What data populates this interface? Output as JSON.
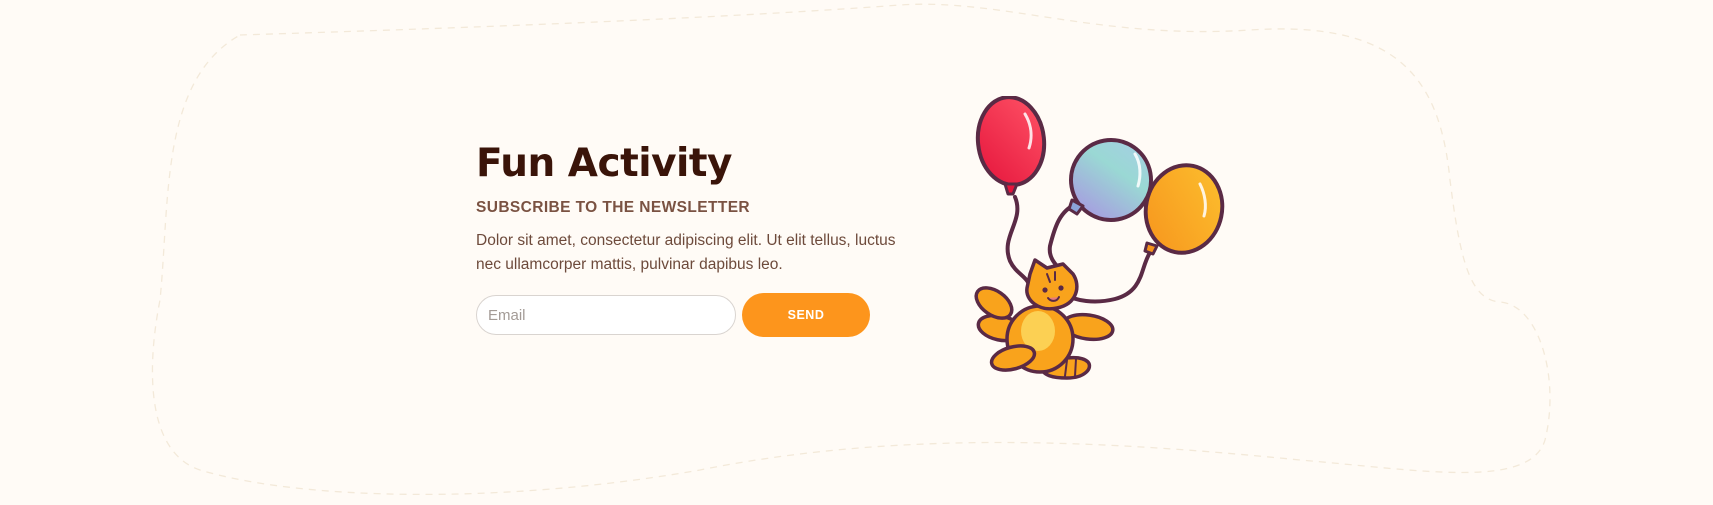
{
  "newsletter": {
    "title": "Fun Activity",
    "subtitle": "SUBSCRIBE TO THE NEWSLETTER",
    "description": "Dolor sit amet, consectetur adipiscing elit. Ut elit tellus, luctus nec ullamcorper mattis, pulvinar dapibus leo.",
    "email_placeholder": "Email",
    "email_value": "",
    "send_label": "SEND"
  },
  "colors": {
    "background": "#fffbf6",
    "title": "#3a1409",
    "subtitle": "#7a5242",
    "text": "#6d4a3b",
    "button": "#fd951c",
    "balloon_red": "#e8213f",
    "balloon_blue": "#a3c9e0",
    "balloon_orange": "#f9a31c",
    "outline": "#5a2a45"
  },
  "illustration": {
    "name": "cat-with-balloons-illustration"
  }
}
